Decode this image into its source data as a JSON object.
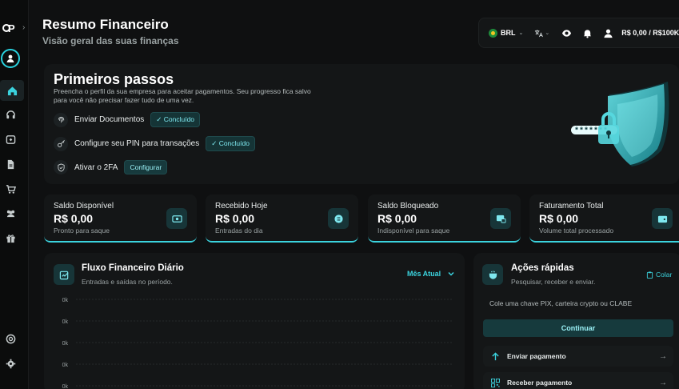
{
  "header": {
    "title": "Resumo Financeiro",
    "subtitle": "Visão geral das suas finanças"
  },
  "brand": {
    "logo_text": "P",
    "accent": "#3bd3de"
  },
  "topbar": {
    "currency": "BRL",
    "balance": "R$ 0,00 / R$100K",
    "icons": [
      "brazil-flag-icon",
      "translate-icon",
      "eye-icon",
      "bell-icon",
      "user-icon"
    ]
  },
  "sidebar": {
    "items": [
      {
        "name": "home",
        "icon": "home-icon",
        "active": true
      },
      {
        "name": "support",
        "icon": "headset-icon"
      },
      {
        "name": "pix",
        "icon": "pix-icon"
      },
      {
        "name": "documents",
        "icon": "document-icon"
      },
      {
        "name": "cart",
        "icon": "cart-icon"
      },
      {
        "name": "users",
        "icon": "users-icon"
      },
      {
        "name": "gifts",
        "icon": "gift-icon"
      },
      {
        "name": "help",
        "icon": "lifebuoy-icon"
      },
      {
        "name": "settings",
        "icon": "gear-icon"
      }
    ]
  },
  "onboarding": {
    "title": "Primeiros passos",
    "description": "Preencha o perfil da sua empresa para aceitar pagamentos. Seu progresso fica salvo para você não precisar fazer tudo de uma vez.",
    "password_mask": "*******",
    "steps": [
      {
        "label": "Enviar Documentos",
        "status": "Concluído"
      },
      {
        "label": "Configure seu PIN para transações",
        "status": "Concluído"
      },
      {
        "label": "Ativar o 2FA",
        "status": "Configurar"
      }
    ]
  },
  "stats": [
    {
      "label": "Saldo Disponível",
      "value": "R$ 0,00",
      "sub": "Pronto para saque"
    },
    {
      "label": "Recebido Hoje",
      "value": "R$ 0,00",
      "sub": "Entradas do dia"
    },
    {
      "label": "Saldo Bloqueado",
      "value": "R$ 0,00",
      "sub": "Indisponível para saque"
    },
    {
      "label": "Faturamento Total",
      "value": "R$ 0,00",
      "sub": "Volume total processado"
    }
  ],
  "flow": {
    "title": "Fluxo Financeiro Diário",
    "subtitle": "Entradas e saídas no período.",
    "period": "Mês Atual"
  },
  "chart_data": {
    "type": "line",
    "y_ticks": [
      "0k",
      "0k",
      "0k",
      "0k",
      "0k"
    ],
    "series": []
  },
  "quick_actions": {
    "title": "Ações rápidas",
    "subtitle": "Pesquisar, receber e enviar.",
    "paste_label": "Colar",
    "input_placeholder": "Cole uma chave PIX, carteira crypto ou CLABE",
    "continue_label": "Continuar",
    "actions": [
      {
        "label": "Enviar pagamento"
      },
      {
        "label": "Receber pagamento"
      }
    ]
  }
}
